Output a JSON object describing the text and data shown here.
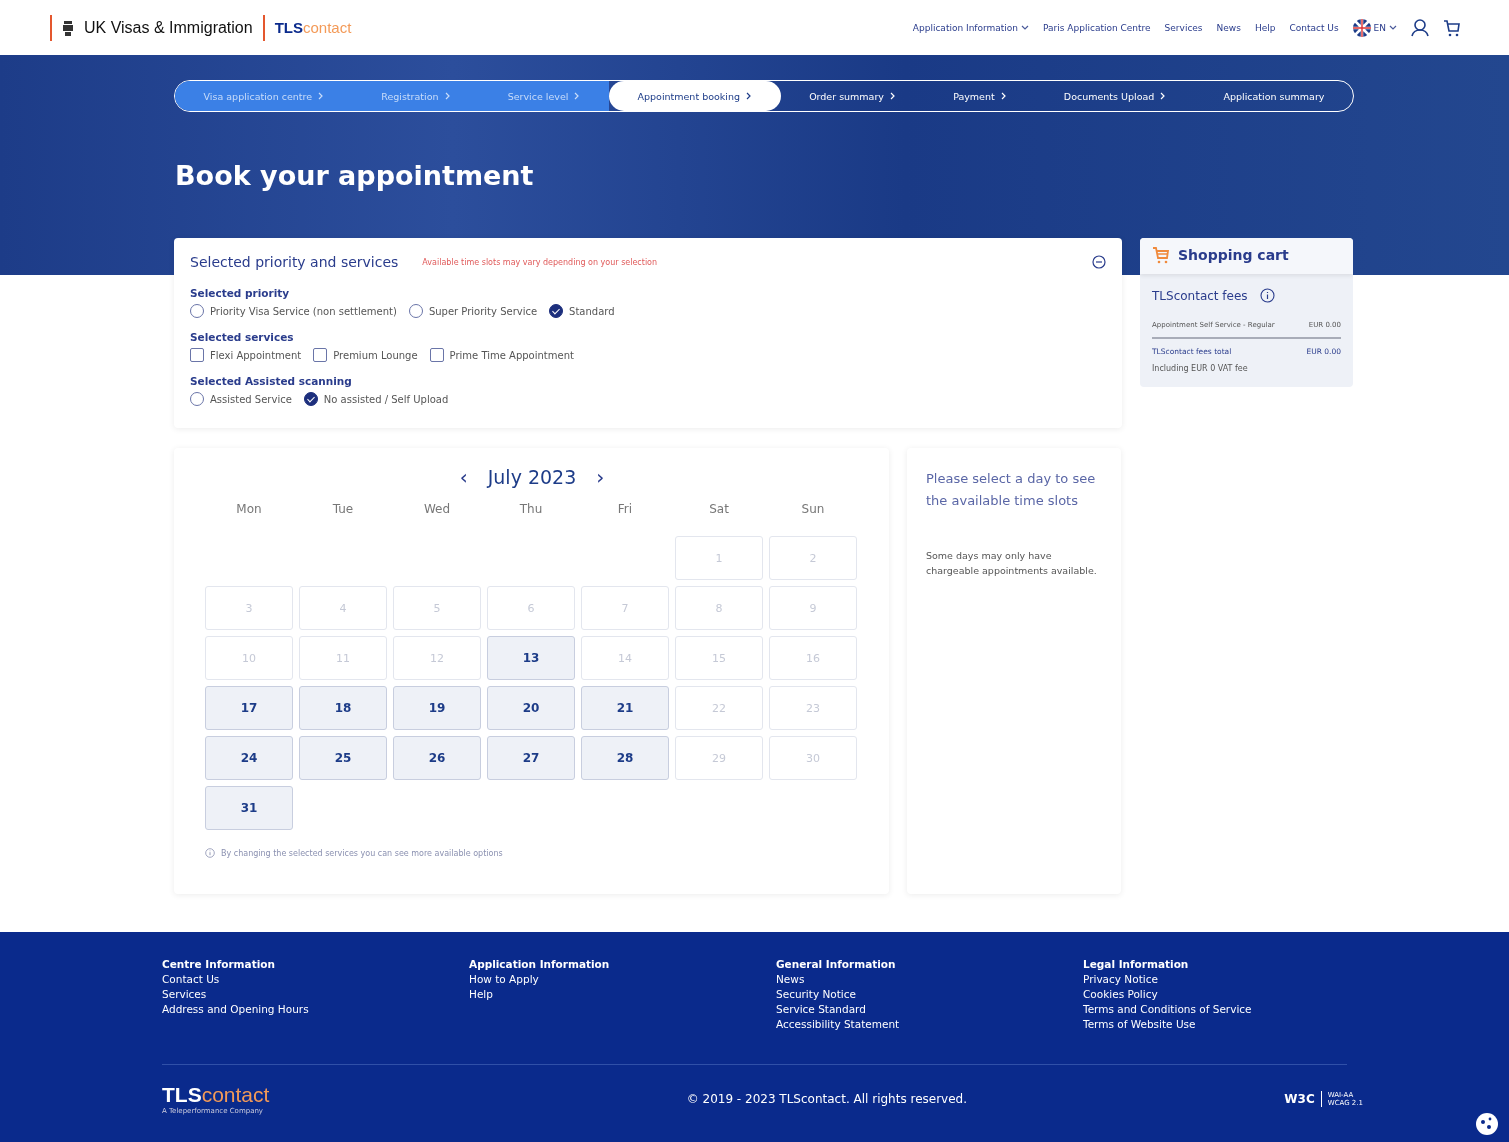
{
  "header": {
    "logo_main": "UK Visas & Immigration",
    "brand_a": "TLS",
    "brand_b": "contact",
    "nav": [
      {
        "label": "Application Information",
        "dropdown": true
      },
      {
        "label": "Paris Application Centre",
        "dropdown": false
      },
      {
        "label": "Services",
        "dropdown": false
      },
      {
        "label": "News",
        "dropdown": false
      },
      {
        "label": "Help",
        "dropdown": false
      },
      {
        "label": "Contact Us",
        "dropdown": false
      }
    ],
    "language": "EN"
  },
  "steps": [
    {
      "label": "Visa application centre",
      "completed": true,
      "selected": false
    },
    {
      "label": "Registration",
      "completed": true,
      "selected": false
    },
    {
      "label": "Service level",
      "completed": true,
      "selected": false
    },
    {
      "label": "Appointment booking",
      "completed": false,
      "selected": true
    },
    {
      "label": "Order summary",
      "completed": false,
      "selected": false
    },
    {
      "label": "Payment",
      "completed": false,
      "selected": false
    },
    {
      "label": "Documents Upload",
      "completed": false,
      "selected": false
    },
    {
      "label": "Application summary",
      "completed": false,
      "selected": false
    }
  ],
  "title": "Book your appointment",
  "services": {
    "title": "Selected priority and services",
    "note": "Available time slots may vary depending on your selection",
    "groups": [
      {
        "label": "Selected priority",
        "kind": "radio",
        "options": [
          {
            "label": "Priority Visa Service (non settlement)",
            "selected": false
          },
          {
            "label": "Super Priority Service",
            "selected": false
          },
          {
            "label": "Standard",
            "selected": true
          }
        ]
      },
      {
        "label": "Selected services",
        "kind": "checkbox",
        "options": [
          {
            "label": "Flexi Appointment",
            "selected": false
          },
          {
            "label": "Premium Lounge",
            "selected": false
          },
          {
            "label": "Prime Time Appointment",
            "selected": false
          }
        ]
      },
      {
        "label": "Selected Assisted scanning",
        "kind": "radio",
        "options": [
          {
            "label": "Assisted Service",
            "selected": false
          },
          {
            "label": "No assisted / Self Upload",
            "selected": true
          }
        ]
      }
    ]
  },
  "calendar": {
    "prev": "‹",
    "month": "July 2023",
    "next": "›",
    "weekdays": [
      "Mon",
      "Tue",
      "Wed",
      "Thu",
      "Fri",
      "Sat",
      "Sun"
    ],
    "weeks": [
      [
        {
          "day": "1",
          "available": false
        },
        {
          "day": "2",
          "available": false
        }
      ],
      [
        {
          "day": "3",
          "available": false
        },
        {
          "day": "4",
          "available": false
        },
        {
          "day": "5",
          "available": false
        },
        {
          "day": "6",
          "available": false
        },
        {
          "day": "7",
          "available": false
        },
        {
          "day": "8",
          "available": false
        },
        {
          "day": "9",
          "available": false
        }
      ],
      [
        {
          "day": "10",
          "available": false
        },
        {
          "day": "11",
          "available": false
        },
        {
          "day": "12",
          "available": false
        },
        {
          "day": "13",
          "available": true
        },
        {
          "day": "14",
          "available": false
        },
        {
          "day": "15",
          "available": false
        },
        {
          "day": "16",
          "available": false
        }
      ],
      [
        {
          "day": "17",
          "available": true
        },
        {
          "day": "18",
          "available": true
        },
        {
          "day": "19",
          "available": true
        },
        {
          "day": "20",
          "available": true
        },
        {
          "day": "21",
          "available": true
        },
        {
          "day": "22",
          "available": false
        },
        {
          "day": "23",
          "available": false
        }
      ],
      [
        {
          "day": "24",
          "available": true
        },
        {
          "day": "25",
          "available": true
        },
        {
          "day": "26",
          "available": true
        },
        {
          "day": "27",
          "available": true
        },
        {
          "day": "28",
          "available": true
        },
        {
          "day": "29",
          "available": false
        },
        {
          "day": "30",
          "available": false
        }
      ],
      [
        {
          "day": "31",
          "available": true
        }
      ]
    ],
    "hint": "By changing the selected services you can see more available options"
  },
  "slots": {
    "heading": "Please select a day to see the available time slots",
    "note": "Some days may only have chargeable appointments available."
  },
  "cart": {
    "title": "Shopping cart",
    "fees_title": "TLScontact fees",
    "items": [
      {
        "label": "Appointment Self Service - Regular",
        "price": "EUR 0.00"
      }
    ],
    "total_label": "TLScontact fees total",
    "total_price": "EUR 0.00",
    "total_note": "Including EUR 0 VAT fee"
  },
  "footer": {
    "columns": [
      {
        "heading": "Centre Information",
        "links": [
          "Contact Us",
          "Services",
          "Address and Opening Hours"
        ]
      },
      {
        "heading": "Application Information",
        "links": [
          "How to Apply",
          "Help"
        ]
      },
      {
        "heading": "General Information",
        "links": [
          "News",
          "Security Notice",
          "Service Standard",
          "Accessibility Statement"
        ]
      },
      {
        "heading": "Legal Information",
        "links": [
          "Privacy Notice",
          "Cookies Policy",
          "Terms and Conditions of Service",
          "Terms of Website Use"
        ]
      }
    ],
    "brand_a": "TLS",
    "brand_b": "contact",
    "brand_tagline": "A Teleperformance Company",
    "copyright": "© 2019 - 2023 TLScontact. All rights reserved.",
    "badge_a": "W3C",
    "badge_b": "WAI-AA",
    "badge_c": "WCAG 2.1"
  }
}
